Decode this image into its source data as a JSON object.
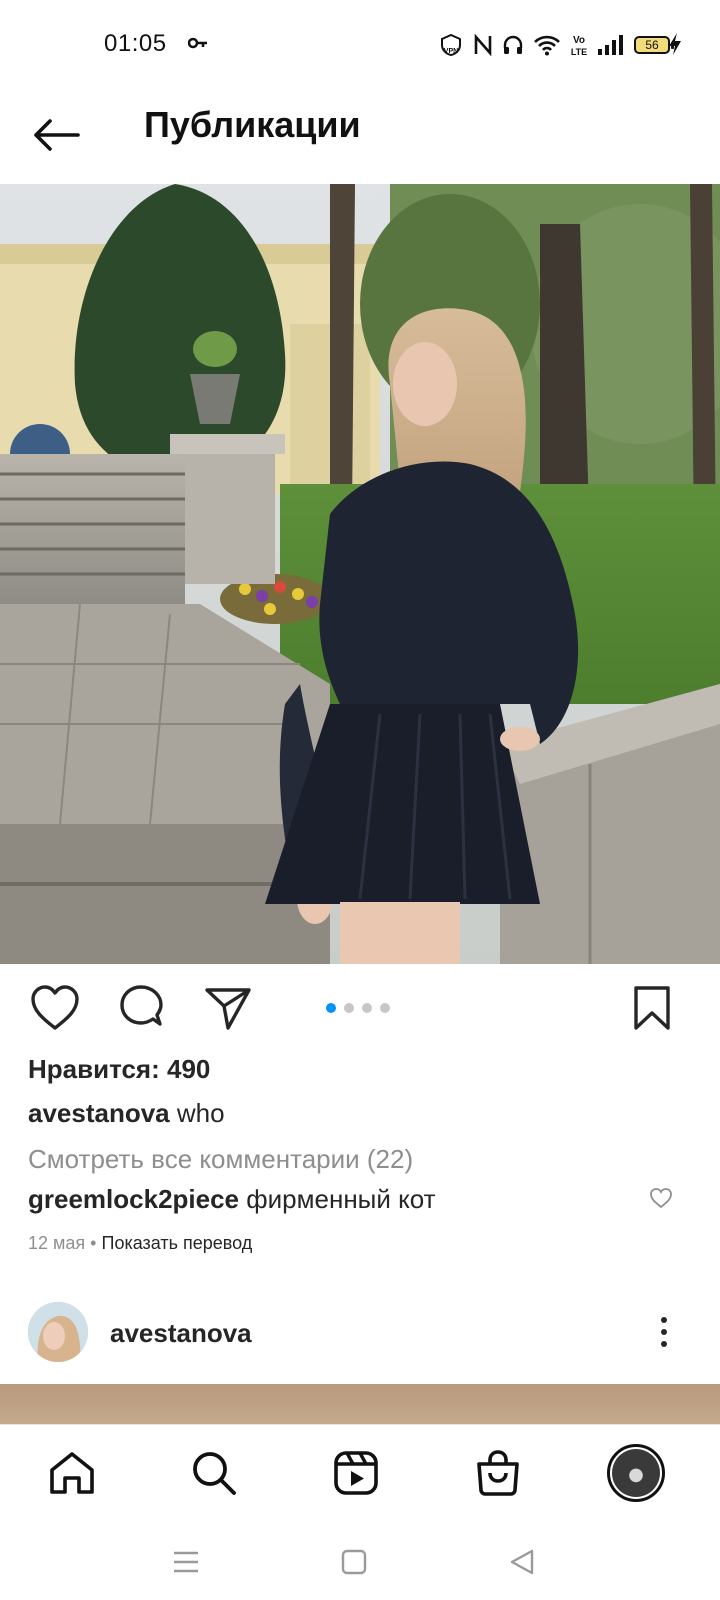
{
  "status_bar": {
    "time": "01:05",
    "battery_level": "56",
    "icons": [
      "key-icon",
      "vpn-icon",
      "nfc-icon",
      "headset-icon",
      "wifi-icon",
      "volte-icon",
      "signal-icon",
      "battery-icon",
      "charging-icon"
    ]
  },
  "header": {
    "title": "Публикации",
    "back_icon": "arrow-left-icon"
  },
  "post": {
    "carousel": {
      "count": 4,
      "active_index": 0,
      "active_color": "#0095f6"
    },
    "likes": "Нравится: 490",
    "author": "avestanova",
    "caption_text": "who",
    "view_all_comments": "Смотреть все комментарии (22)",
    "comment": {
      "user": "greemlock2piece",
      "text": "фирменный кот"
    },
    "date": "12 мая",
    "separator": "•",
    "translate": "Показать перевод"
  },
  "next_post": {
    "username": "avestanova"
  },
  "bottom_nav": {
    "items": [
      "home-icon",
      "search-icon",
      "reels-icon",
      "shop-icon",
      "profile-avatar"
    ]
  },
  "system_nav": {
    "items": [
      "menu-icon",
      "home-square-icon",
      "back-triangle-icon"
    ]
  }
}
